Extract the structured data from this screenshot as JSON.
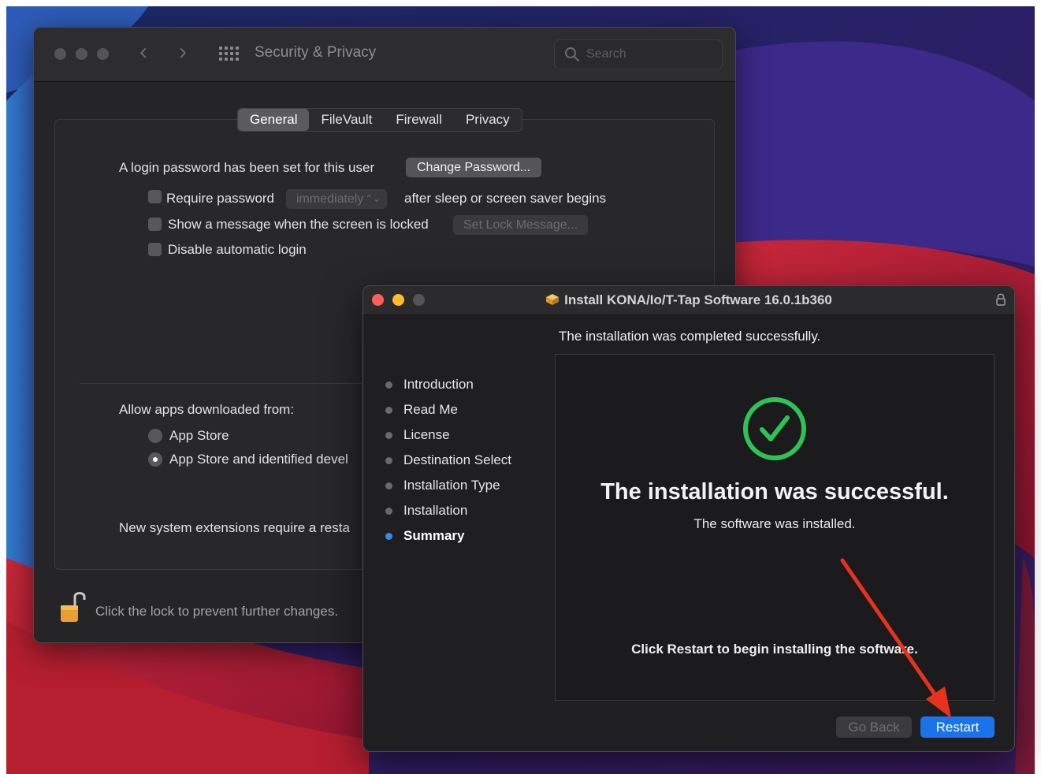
{
  "security_privacy": {
    "title": "Security & Privacy",
    "search_placeholder": "Search",
    "tabs": [
      {
        "label": "General",
        "active": true
      },
      {
        "label": "FileVault",
        "active": false
      },
      {
        "label": "Firewall",
        "active": false
      },
      {
        "label": "Privacy",
        "active": false
      }
    ],
    "login_password_text": "A login password has been set for this user",
    "change_password_label": "Change Password...",
    "require_password_label": "Require password",
    "require_password_select": "immediately",
    "require_password_suffix": "after sleep or screen saver begins",
    "show_message_label": "Show a message when the screen is locked",
    "set_lock_message_label": "Set Lock Message...",
    "disable_login_label": "Disable automatic login",
    "allow_apps_label": "Allow apps downloaded from:",
    "radio_options": [
      {
        "label": "App Store",
        "selected": false
      },
      {
        "label": "App Store and identified devel",
        "selected": true
      }
    ],
    "extensions_text": "New system extensions require a resta",
    "lock_text": "Click the lock to prevent further changes."
  },
  "installer": {
    "title": "Install KONA/Io/T-Tap Software 16.0.1b360",
    "status_top": "The installation was completed successfully.",
    "steps": [
      {
        "label": "Introduction",
        "current": false
      },
      {
        "label": "Read Me",
        "current": false
      },
      {
        "label": "License",
        "current": false
      },
      {
        "label": "Destination Select",
        "current": false
      },
      {
        "label": "Installation Type",
        "current": false
      },
      {
        "label": "Installation",
        "current": false
      },
      {
        "label": "Summary",
        "current": true
      }
    ],
    "success_heading": "The installation was successful.",
    "success_sub": "The software was installed.",
    "restart_note": "Click Restart to begin installing the software.",
    "go_back_label": "Go Back",
    "restart_label": "Restart"
  },
  "colors": {
    "accent_blue": "#1a73e8",
    "success_green": "#2ec455",
    "annotation_red": "#e8321e",
    "traffic_red": "#ff5f57",
    "traffic_yellow": "#febc2e"
  },
  "icons": {
    "search": "search-icon",
    "lock": "unlocked-padlock-icon",
    "package": "package-icon",
    "success": "checkmark-circle-icon",
    "grid": "grid-icon"
  }
}
